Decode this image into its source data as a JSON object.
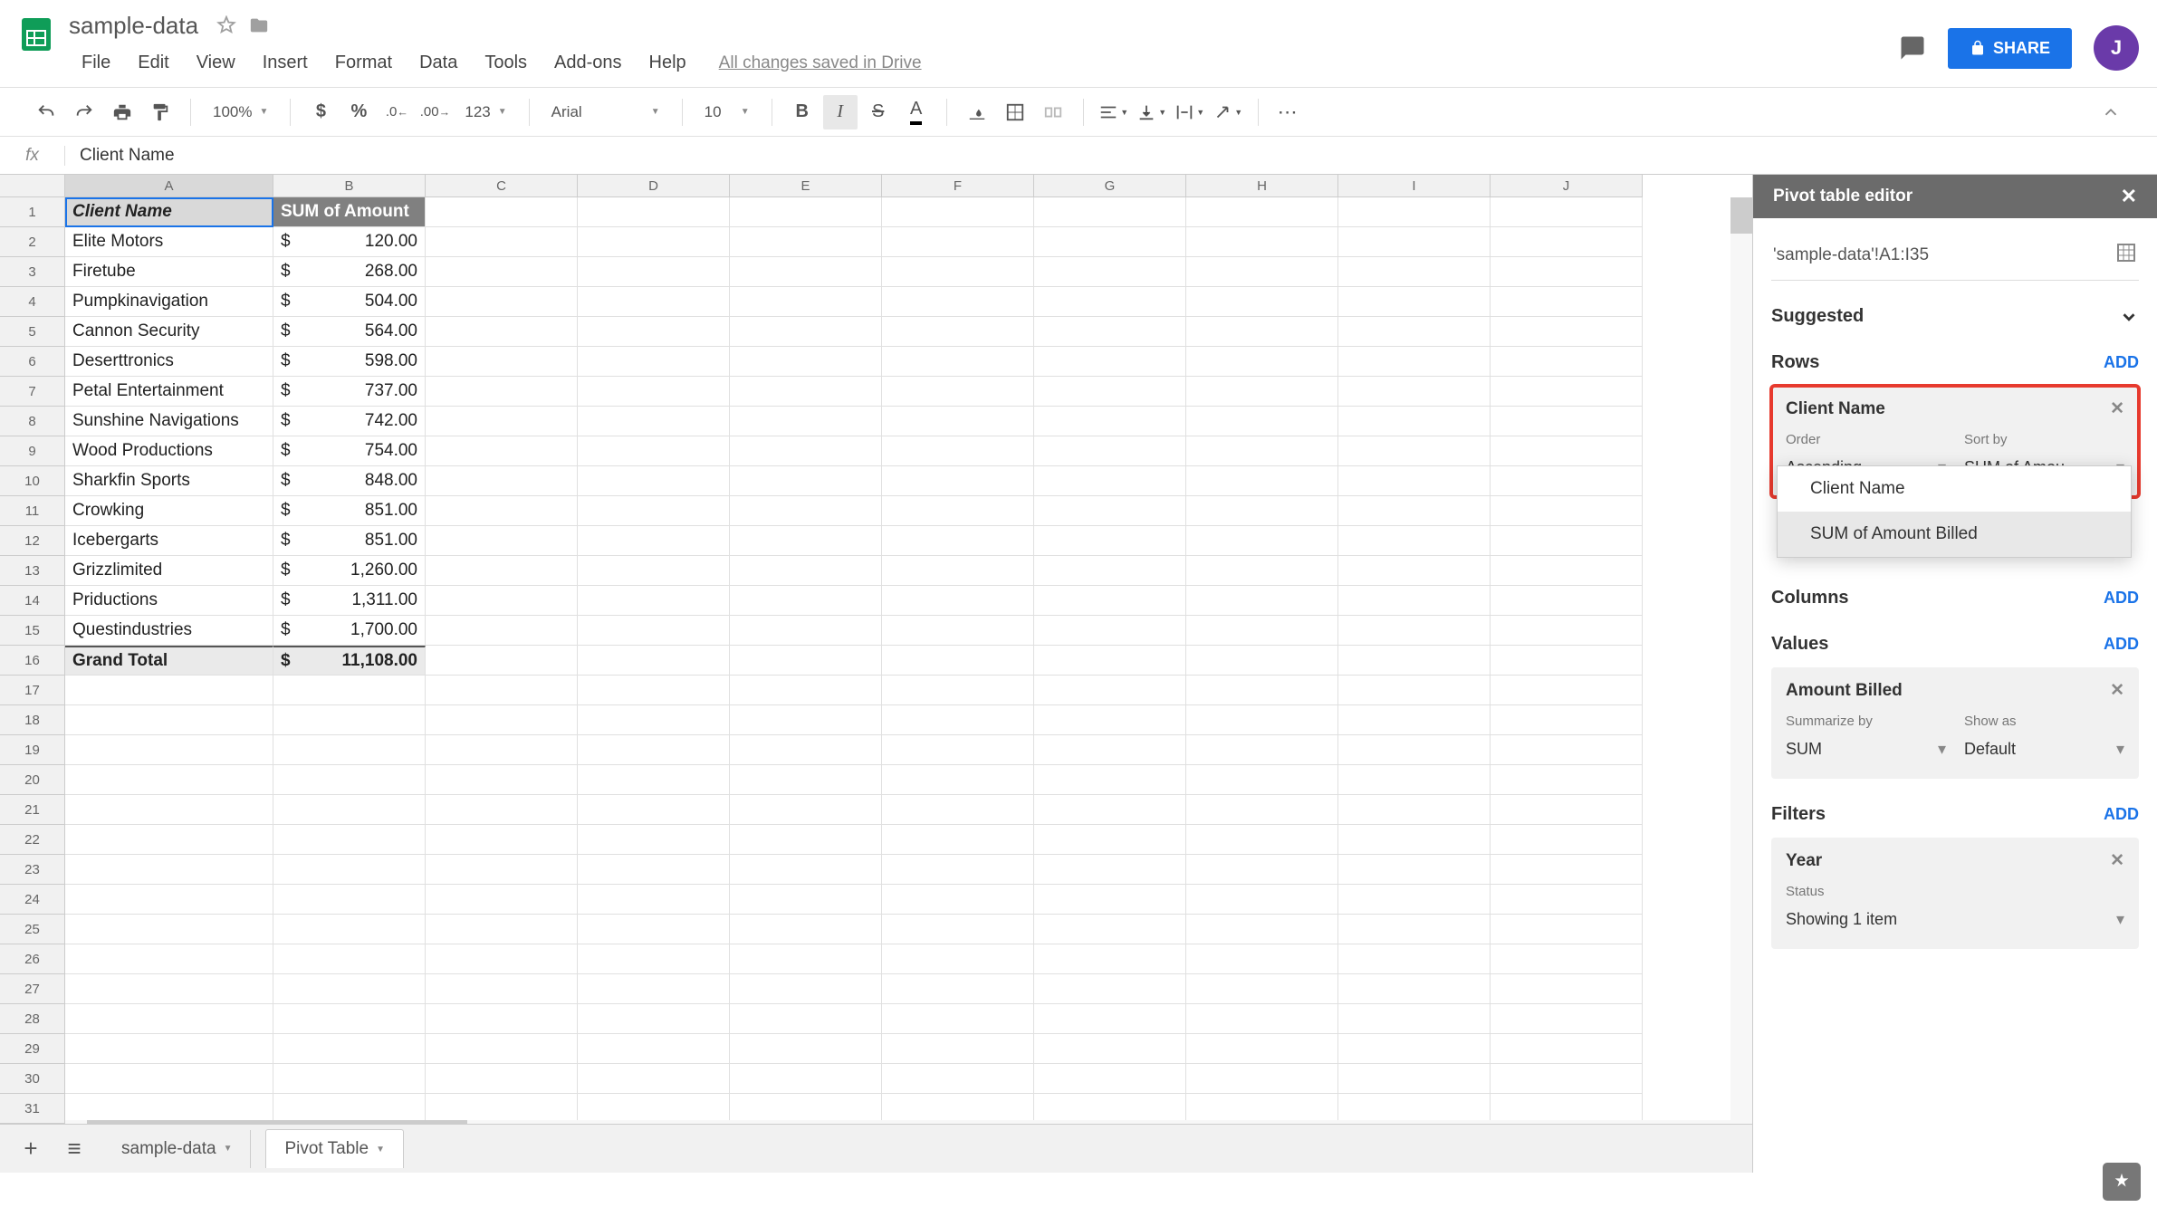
{
  "doc": {
    "title": "sample-data",
    "saved": "All changes saved in Drive"
  },
  "menus": [
    "File",
    "Edit",
    "View",
    "Insert",
    "Format",
    "Data",
    "Tools",
    "Add-ons",
    "Help"
  ],
  "share": "SHARE",
  "avatar_letter": "J",
  "toolbar": {
    "zoom": "100%",
    "font": "Arial",
    "size": "10",
    "more": "123"
  },
  "formula": {
    "label": "fx",
    "value": "Client Name"
  },
  "columns": [
    "A",
    "B",
    "C",
    "D",
    "E",
    "F",
    "G",
    "H",
    "I",
    "J"
  ],
  "pivot_table": {
    "headers": [
      "Client Name",
      "SUM of  Amount"
    ],
    "rows": [
      {
        "name": "Elite Motors",
        "amount": "120.00"
      },
      {
        "name": "Firetube",
        "amount": "268.00"
      },
      {
        "name": "Pumpkinavigation",
        "amount": "504.00"
      },
      {
        "name": "Cannon Security",
        "amount": "564.00"
      },
      {
        "name": "Deserttronics",
        "amount": "598.00"
      },
      {
        "name": "Petal Entertainment",
        "amount": "737.00"
      },
      {
        "name": "Sunshine Navigations",
        "amount": "742.00"
      },
      {
        "name": "Wood Productions",
        "amount": "754.00"
      },
      {
        "name": "Sharkfin Sports",
        "amount": "848.00"
      },
      {
        "name": "Crowking",
        "amount": "851.00"
      },
      {
        "name": "Icebergarts",
        "amount": "851.00"
      },
      {
        "name": "Grizzlimited",
        "amount": "1,260.00"
      },
      {
        "name": "Priductions",
        "amount": "1,311.00"
      },
      {
        "name": "Questindustries",
        "amount": "1,700.00"
      }
    ],
    "total_label": "Grand Total",
    "total_amount": "11,108.00",
    "currency": "$"
  },
  "row_count": 31,
  "sheets": {
    "tab1": "sample-data",
    "tab2": "Pivot Table"
  },
  "pivot_editor": {
    "title": "Pivot table editor",
    "range": "'sample-data'!A1:I35",
    "suggested": "Suggested",
    "rows_label": "Rows",
    "add": "ADD",
    "row_card": {
      "title": "Client Name",
      "order_label": "Order",
      "order_val": "Ascending",
      "sort_label": "Sort by",
      "sort_val": "SUM of Amou…"
    },
    "dropdown": {
      "opt1": "Client Name",
      "opt2": "SUM of Amount Billed"
    },
    "columns_label": "Columns",
    "values_label": "Values",
    "value_card": {
      "title": "Amount Billed",
      "sum_label": "Summarize by",
      "sum_val": "SUM",
      "show_label": "Show as",
      "show_val": "Default"
    },
    "filters_label": "Filters",
    "filter_card": {
      "title": "Year",
      "status_label": "Status",
      "status_val": "Showing 1 item"
    }
  }
}
